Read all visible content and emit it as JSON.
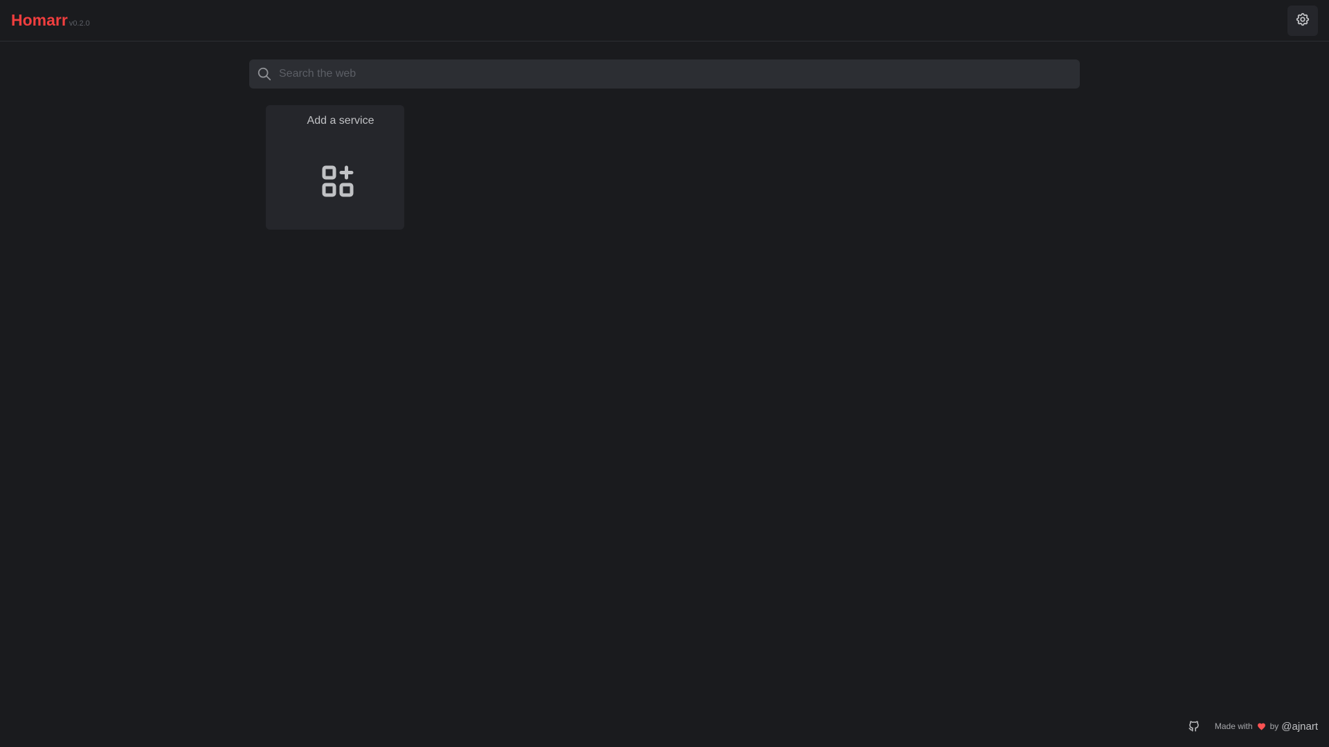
{
  "header": {
    "title": "Homarr",
    "version": "v0.2.0",
    "settings_icon": "gear-icon"
  },
  "search": {
    "placeholder": "Search the web",
    "value": "",
    "icon": "search-icon"
  },
  "services": {
    "add_card": {
      "title": "Add a service",
      "icon": "apps-add-icon"
    }
  },
  "footer": {
    "github_icon": "github-icon",
    "made_with": "Made with",
    "heart_icon": "heart-icon",
    "by": "by",
    "author": "@ajnart"
  },
  "colors": {
    "background": "#1a1b1e",
    "brand": "#f03e3e",
    "card": "#25262b",
    "input": "#2c2e33",
    "heart": "#fa5252"
  }
}
